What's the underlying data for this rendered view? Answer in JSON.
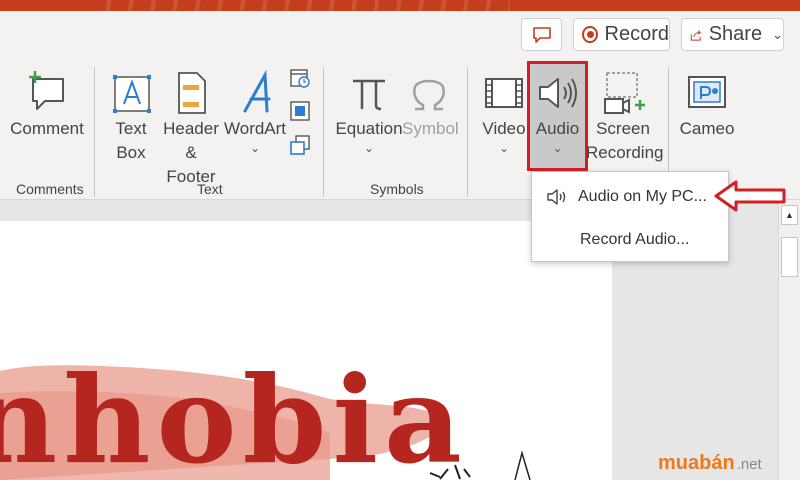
{
  "topbar": {
    "record_label": "Record",
    "share_label": "Share"
  },
  "ribbon": {
    "comment": "Comment",
    "text_box_1": "Text",
    "text_box_2": "Box",
    "header_footer_1": "Header",
    "header_footer_2": "& Footer",
    "wordart": "WordArt",
    "equation": "Equation",
    "symbol": "Symbol",
    "video": "Video",
    "audio": "Audio",
    "screen_recording_1": "Screen",
    "screen_recording_2": "Recording",
    "cameo": "Cameo",
    "groups": {
      "comments": "Comments",
      "text": "Text",
      "symbols": "Symbols"
    }
  },
  "audio_menu": {
    "items": [
      "Audio on My PC...",
      "Record Audio..."
    ]
  },
  "slide": {
    "title_fragment": "nhobia"
  },
  "watermark": {
    "brand": "muabán",
    "tld": ".net"
  },
  "colors": {
    "accent": "#c43e1c",
    "highlight": "#d11f26",
    "icon_blue": "#2b7cd3"
  }
}
